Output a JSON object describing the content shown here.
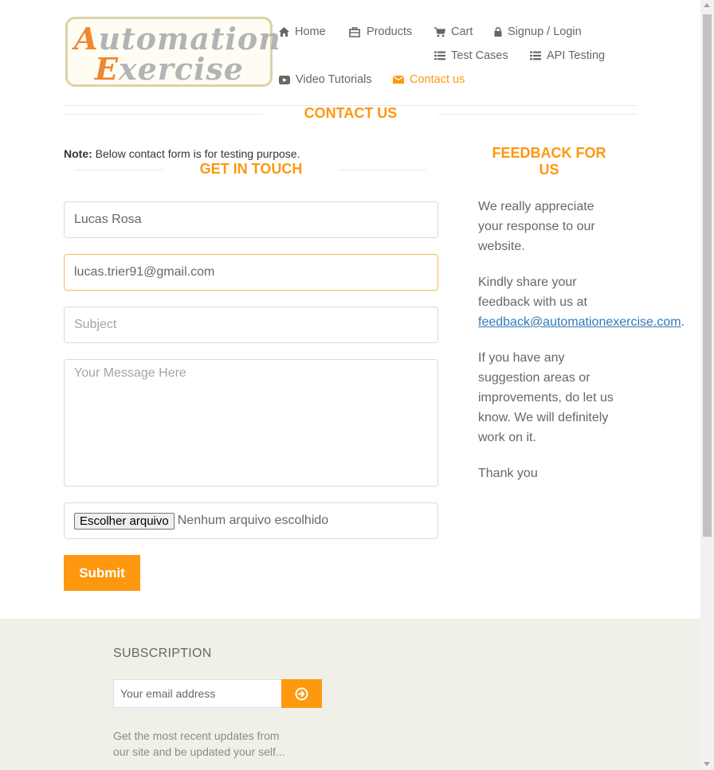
{
  "logo": {
    "line1_cap": "A",
    "line1_rest": "utomation",
    "line2_cap": "E",
    "line2_rest": "xercise"
  },
  "nav": {
    "home": "Home",
    "products": "Products",
    "cart": "Cart",
    "signup_login": "Signup / Login",
    "test_cases": "Test Cases",
    "api_testing": "API Testing",
    "video_tutorials": "Video Tutorials",
    "contact_us": "Contact us"
  },
  "page": {
    "title": "CONTACT US",
    "note_label": "Note:",
    "note_text": " Below contact form is for testing purpose.",
    "get_in_touch": "GET IN TOUCH"
  },
  "form": {
    "name_value": "Lucas Rosa",
    "email_value": "lucas.trier91@gmail.com",
    "subject_placeholder": "Subject",
    "message_placeholder": "Your Message Here",
    "file_button": "Escolher arquivo",
    "file_status": "Nenhum arquivo escolhido",
    "submit": "Submit"
  },
  "feedback": {
    "title": "FEEDBACK FOR US",
    "p1": "We really appreciate your response to our website.",
    "p2_before": "Kindly share your feedback with us at ",
    "p2_link": "feedback@automationexercise.com",
    "p2_after": ".",
    "p3": "If you have any suggestion areas or improvements, do let us know. We will definitely work on it.",
    "p4": "Thank you"
  },
  "footer": {
    "subscription_title": "SUBSCRIPTION",
    "email_placeholder": "Your email address",
    "description": "Get the most recent updates from our site and be updated your self..."
  },
  "colors": {
    "accent": "#fe980f",
    "link": "#337ab7",
    "footer_bg": "#f0f0e9"
  },
  "icons": [
    "home-icon",
    "products-icon",
    "cart-icon",
    "lock-icon",
    "list-icon",
    "video-icon",
    "envelope-icon",
    "arrow-circle-right-icon"
  ]
}
